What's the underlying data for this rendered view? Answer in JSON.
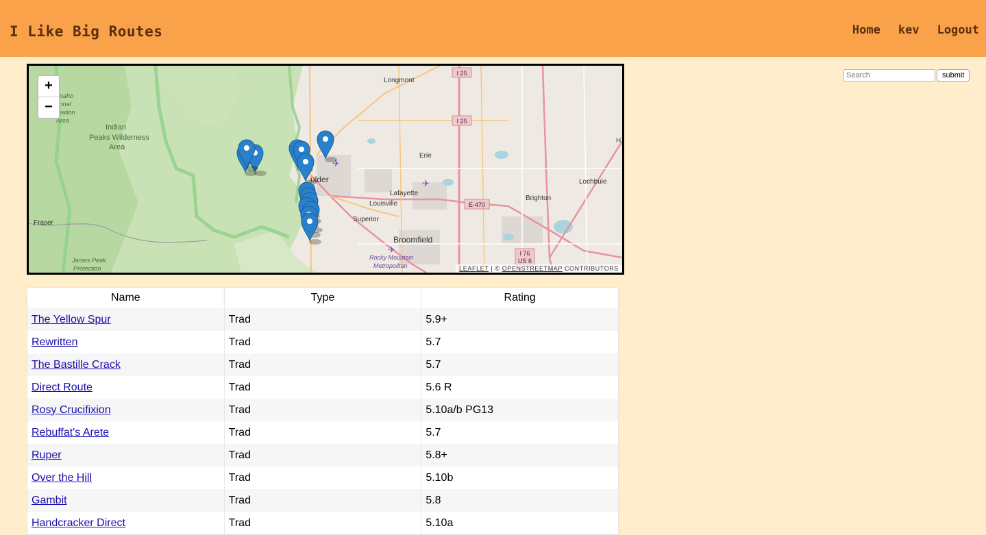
{
  "header": {
    "brand": "I Like Big Routes",
    "nav": [
      "Home",
      "kev",
      "Logout"
    ]
  },
  "search": {
    "placeholder": "Search",
    "submit_label": "submit"
  },
  "map": {
    "zoom_in": "+",
    "zoom_out": "−",
    "attribution": {
      "leaflet": "Leaflet",
      "separator": " | © ",
      "osm": "OpenStreetMap",
      "suffix": " contributors"
    },
    "place_labels": [
      "Longmont",
      "Indian",
      "Peaks Wilderness",
      "Area",
      "apaho",
      "tional",
      "reation",
      "Area",
      "Erie",
      "ulder",
      "Lafayette",
      "Louisville",
      "Superior",
      "Broomfield",
      "Brighton",
      "Lochbuie",
      "Fraser",
      "James Peak",
      "Protection",
      "Rocky Mountain",
      "Metropolitan",
      "I 25",
      "I 25",
      "E-470",
      "I 76",
      "US 6",
      "H"
    ],
    "marker_count": 14
  },
  "table": {
    "columns": [
      "Name",
      "Type",
      "Rating"
    ],
    "rows": [
      {
        "name": "The Yellow Spur",
        "type": "Trad",
        "rating": "5.9+"
      },
      {
        "name": "Rewritten",
        "type": "Trad",
        "rating": "5.7"
      },
      {
        "name": "The Bastille Crack",
        "type": "Trad",
        "rating": "5.7"
      },
      {
        "name": "Direct Route",
        "type": "Trad",
        "rating": "5.6 R"
      },
      {
        "name": "Rosy Crucifixion",
        "type": "Trad",
        "rating": "5.10a/b PG13"
      },
      {
        "name": "Rebuffat's Arete",
        "type": "Trad",
        "rating": "5.7"
      },
      {
        "name": "Ruper",
        "type": "Trad",
        "rating": "5.8+"
      },
      {
        "name": "Over the Hill",
        "type": "Trad",
        "rating": "5.10b"
      },
      {
        "name": "Gambit",
        "type": "Trad",
        "rating": "5.8"
      },
      {
        "name": "Handcracker Direct",
        "type": "Trad",
        "rating": "5.10a"
      }
    ]
  },
  "colors": {
    "header_bg": "#f9a24a",
    "page_bg": "#ffedcc",
    "brand_text": "#5a2d0c",
    "link": "#1a0dab",
    "marker": "#2a81cb"
  }
}
